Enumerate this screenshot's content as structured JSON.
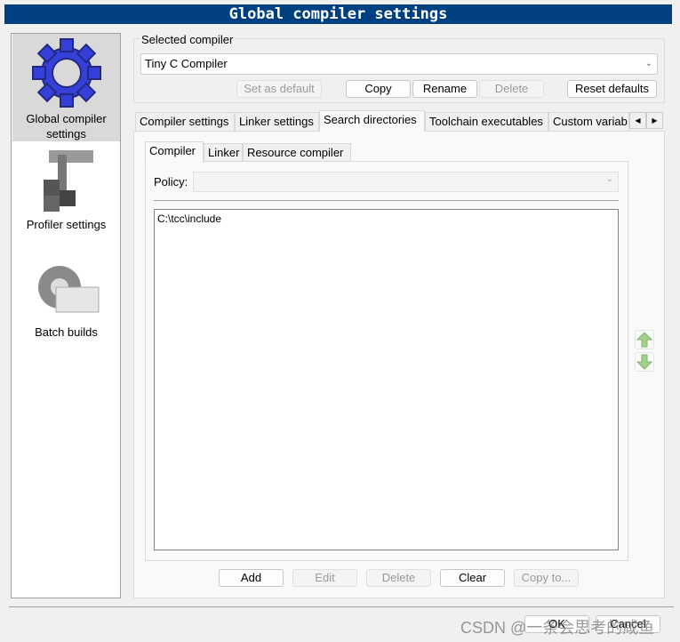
{
  "window": {
    "title": "Global compiler settings"
  },
  "sidebar": {
    "items": [
      {
        "label": "Global compiler settings",
        "icon": "gear-icon",
        "selected": true
      },
      {
        "label": "Profiler settings",
        "icon": "profiler-icon",
        "selected": false
      },
      {
        "label": "Batch builds",
        "icon": "batch-builds-icon",
        "selected": false
      }
    ]
  },
  "compiler": {
    "group_label": "Selected compiler",
    "selected": "Tiny C Compiler",
    "buttons": {
      "set_default": "Set as default",
      "copy": "Copy",
      "rename": "Rename",
      "delete": "Delete",
      "reset": "Reset defaults"
    }
  },
  "tabs": [
    "Compiler settings",
    "Linker settings",
    "Search directories",
    "Toolchain executables",
    "Custom variab"
  ],
  "active_tab": "Search directories",
  "subtabs": [
    "Compiler",
    "Linker",
    "Resource compiler"
  ],
  "active_subtab": "Compiler",
  "policy": {
    "label": "Policy:",
    "value": ""
  },
  "directories": [
    "C:\\tcc\\include"
  ],
  "list_buttons": {
    "add": "Add",
    "edit": "Edit",
    "delete": "Delete",
    "clear": "Clear",
    "copy_to": "Copy to..."
  },
  "dialog_buttons": {
    "ok": "OK",
    "cancel": "Cancel"
  },
  "watermark": "CSDN @一条会思考的咸鱼",
  "colors": {
    "titlebar": "#003f80",
    "arrow": "#9fd28a"
  }
}
